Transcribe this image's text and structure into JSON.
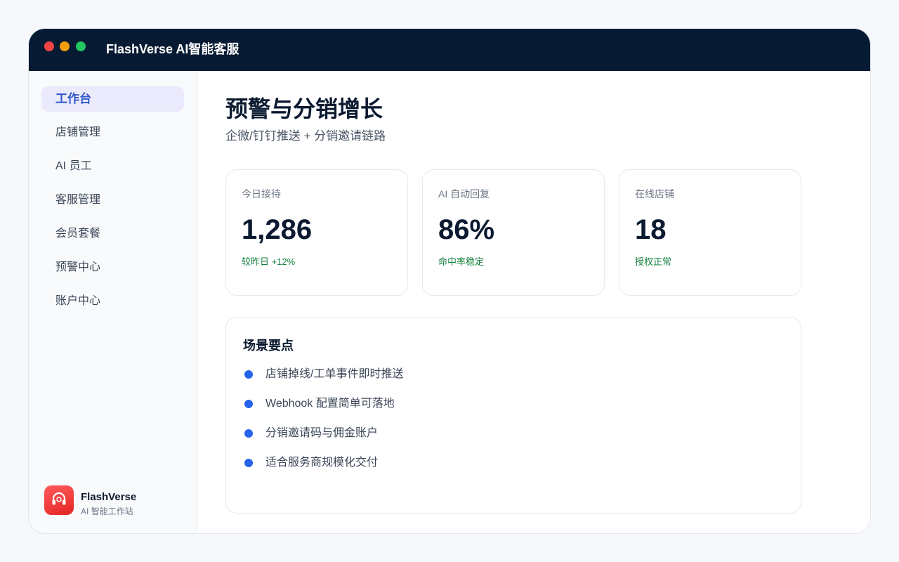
{
  "window": {
    "title": "FlashVerse AI智能客服"
  },
  "sidebar": {
    "items": [
      {
        "label": "工作台",
        "active": true
      },
      {
        "label": "店铺管理"
      },
      {
        "label": "AI 员工"
      },
      {
        "label": "客服管理"
      },
      {
        "label": "会员套餐"
      },
      {
        "label": "预警中心"
      },
      {
        "label": "账户中心"
      }
    ],
    "brand": {
      "name": "FlashVerse",
      "subtitle": "AI 智能工作站",
      "logo_icon": "headset-icon"
    }
  },
  "main": {
    "title": "预警与分销增长",
    "subtitle": "企微/钉钉推送 + 分销邀请链路",
    "stats": [
      {
        "label": "今日接待",
        "value": "1,286",
        "note": "较昨日 +12%"
      },
      {
        "label": "AI 自动回复",
        "value": "86%",
        "note": "命中率稳定"
      },
      {
        "label": "在线店铺",
        "value": "18",
        "note": "授权正常"
      }
    ],
    "points": {
      "title": "场景要点",
      "items": [
        "店铺掉线/工单事件即时推送",
        "Webhook 配置简单可落地",
        "分销邀请码与佣金账户",
        "适合服务商规模化交付"
      ]
    }
  },
  "colors": {
    "titlebar": "#071a33",
    "accent": "#2f58c7",
    "positive": "#15803d",
    "bullet": "#2563eb",
    "logo": "#e52424"
  }
}
